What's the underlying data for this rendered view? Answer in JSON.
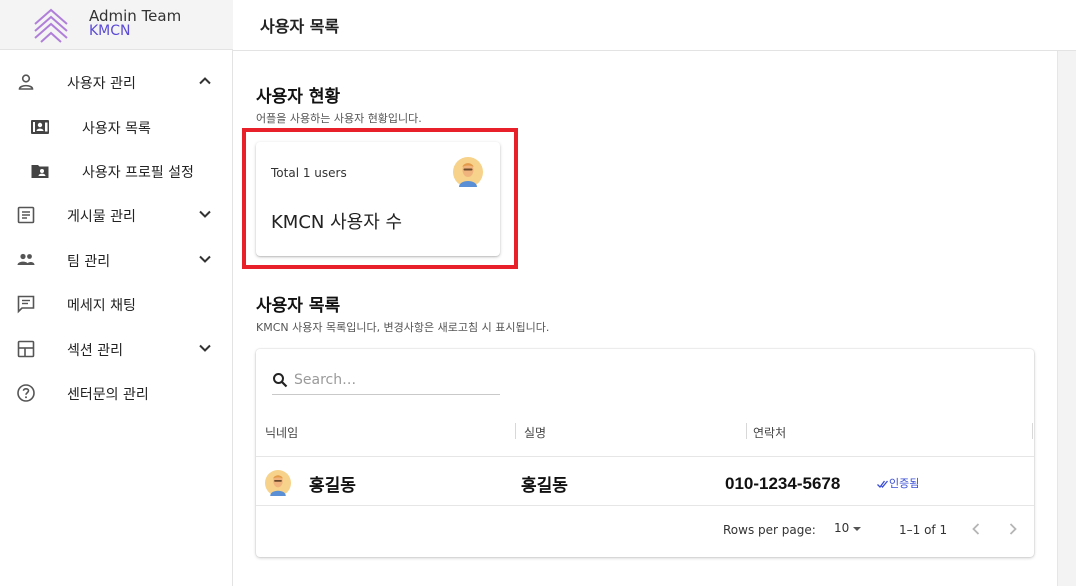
{
  "brand": {
    "title": "Admin Team",
    "subtitle": "KMCN"
  },
  "header": {
    "title": "사용자 목록"
  },
  "sidebar": {
    "items": [
      {
        "label": "사용자 관리",
        "icon": "person-icon",
        "expanded": true
      },
      {
        "label": "사용자 목록",
        "icon": "contact-card-icon"
      },
      {
        "label": "사용자 프로필 설정",
        "icon": "folder-person-icon"
      },
      {
        "label": "게시물 관리",
        "icon": "article-icon"
      },
      {
        "label": "팀 관리",
        "icon": "group-icon"
      },
      {
        "label": "메세지 채팅",
        "icon": "chat-icon"
      },
      {
        "label": "섹션 관리",
        "icon": "layout-icon"
      },
      {
        "label": "센터문의 관리",
        "icon": "help-circle-icon"
      }
    ]
  },
  "status": {
    "title": "사용자 현황",
    "description": "어플을 사용하는 사용자 현황입니다.",
    "total_label": "Total 1 users",
    "count_label": "KMCN 사용자 수"
  },
  "users": {
    "title": "사용자 목록",
    "description": "KMCN 사용자 목록입니다, 변경사항은 새로고침 시 표시됩니다.",
    "search_placeholder": "Search…",
    "columns": [
      "닉네임",
      "실명",
      "연락처"
    ],
    "rows": [
      {
        "nickname": "홍길동",
        "name": "홍길동",
        "phone": "010-1234-5678",
        "verified": "인증됨"
      }
    ],
    "pagination": {
      "rows_per_page_label": "Rows per page:",
      "rows_per_page": "10",
      "range": "1–1 of 1"
    }
  },
  "colors": {
    "accent": "#5b4bd6",
    "highlight": "#e8202a",
    "verified": "#3b4fd6"
  }
}
